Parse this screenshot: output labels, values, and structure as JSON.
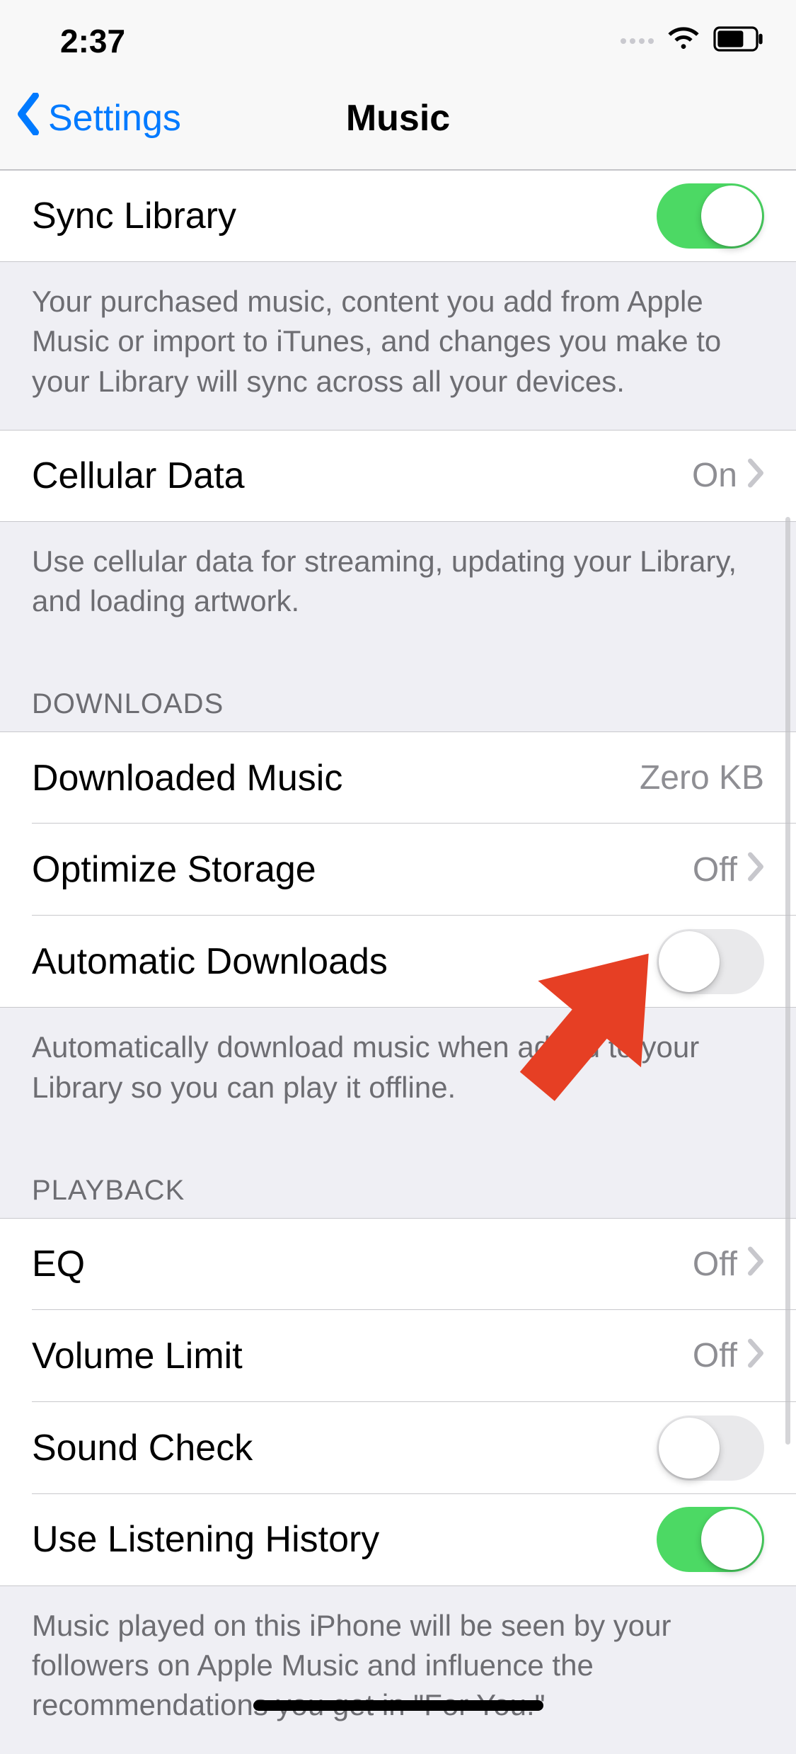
{
  "status": {
    "time": "2:37"
  },
  "nav": {
    "back": "Settings",
    "title": "Music"
  },
  "library": {
    "sync": {
      "label": "Sync Library",
      "on": true
    },
    "sync_footer": "Your purchased music, content you add from Apple Music or import to iTunes, and changes you make to your Library will sync across all your devices.",
    "cellular": {
      "label": "Cellular Data",
      "value": "On"
    },
    "cellular_footer": "Use cellular data for streaming, updating your Library, and loading artwork."
  },
  "downloads": {
    "header": "DOWNLOADS",
    "downloaded": {
      "label": "Downloaded Music",
      "value": "Zero KB"
    },
    "optimize": {
      "label": "Optimize Storage",
      "value": "Off"
    },
    "auto": {
      "label": "Automatic Downloads",
      "on": false
    },
    "auto_footer": "Automatically download music when added to your Library so you can play it offline."
  },
  "playback": {
    "header": "PLAYBACK",
    "eq": {
      "label": "EQ",
      "value": "Off"
    },
    "volume_limit": {
      "label": "Volume Limit",
      "value": "Off"
    },
    "sound_check": {
      "label": "Sound Check",
      "on": false
    },
    "listening_history": {
      "label": "Use Listening History",
      "on": true
    },
    "history_footer": "Music played on this iPhone will be seen by your followers on Apple Music and influence the recommendations you get in \"For You.\""
  }
}
